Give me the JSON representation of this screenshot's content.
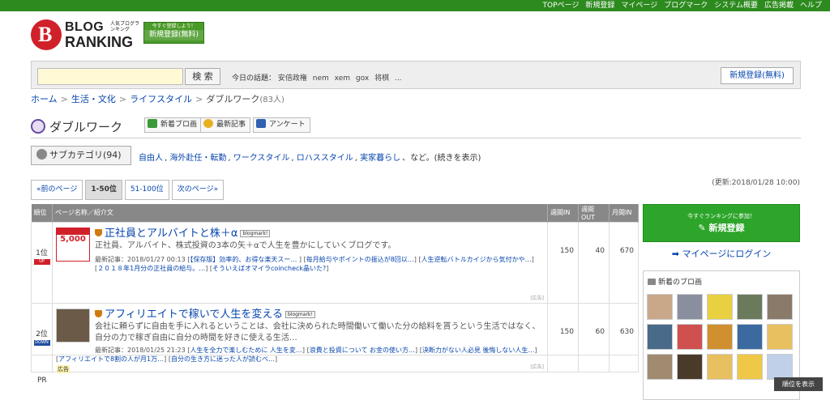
{
  "topnav": [
    "TOPページ",
    "新規登録",
    "マイページ",
    "ブログマーク",
    "システム概要",
    "広告掲載",
    "ヘルプ"
  ],
  "logo": {
    "line1": "BLOG",
    "line2": "RANKING",
    "tagline": "人気ブログランキング"
  },
  "reg_banner": {
    "small": "今すぐ登録しよう！",
    "main": "新規登録(無料)"
  },
  "search": {
    "value": "",
    "button": "検 索",
    "topics_label": "今日の話題：",
    "topics": [
      "安倍政権",
      "nem",
      "xem",
      "gox",
      "将棋",
      "..."
    ],
    "register": "新規登録(無料)"
  },
  "breadcrumb": {
    "home": "ホーム",
    "c1": "生活・文化",
    "c2": "ライフスタイル",
    "current": "ダブルワーク",
    "count": "(83人)"
  },
  "category": {
    "title": "ダブルワーク",
    "btn_new": "新着ブロ画",
    "btn_latest": "最新記事",
    "btn_survey": "アンケート"
  },
  "subcat": {
    "button": "サブカテゴリ(94)",
    "links": [
      "自由人",
      "海外赴任・転勤",
      "ワークスタイル",
      "ロハススタイル",
      "実家暮らし"
    ],
    "suffix": "など。(続きを表示)"
  },
  "updated": "(更新:2018/01/28 10:00)",
  "pager": {
    "prev": "«前のページ",
    "current": "1-50位",
    "next_range": "51-100位",
    "next": "次のページ»"
  },
  "table": {
    "headers": {
      "rank": "順位",
      "name": "ページ名称／紹介文",
      "in_week": "週間IN",
      "out_week": "週間OUT",
      "in_month": "月間IN"
    },
    "rows": [
      {
        "rank": "1位",
        "badge": "UP",
        "title": "正社員とアルバイトと株＋α",
        "bm": "blogmark!",
        "desc": "正社員、アルバイト、株式投資の3本の矢＋αで人生を豊かにしていくブログです。",
        "latest_label": "最新記事：2018/01/27 00:13 [",
        "latest_links": [
          "【保存版】効率的、お得な楽天スー…",
          "毎月給与やポイントの振込が8回以…",
          "人生逆転バトルカイジから気付かや…",
          "２０１８年1月分の正社員の給与。…",
          "そういえばオマイラcoincheck晶いた?"
        ],
        "ad": "[広告]",
        "in_week": "150",
        "out_week": "40",
        "in_month": "670",
        "thumb_text": "5,000"
      },
      {
        "rank": "2位",
        "badge": "DOWN",
        "title": "アフィリエイトで稼いで人生を変える",
        "bm": "blogmark!",
        "desc": "会社に頼らずに自由を手に入れるということは、会社に決められた時間働いて働いた分の給料を貰うという生活ではなく、自分の力で稼ぎ自由に自分の時間を好きに使える生活…",
        "latest_label": "最新記事：2018/01/25 21:23 [",
        "latest_links": [
          "人生を全力で楽しむために 人生を変…",
          "浪費と投資について お金の使い方…",
          "決断力がない人必見 後悔しない人生…",
          "アフィリエイトで8割の人が月1万…",
          "自分の生き方に迷った人が読むべ…"
        ],
        "ad": "[広告]",
        "in_week": "150",
        "out_week": "60",
        "in_month": "630"
      }
    ],
    "pr": "PR",
    "ad_label": "広告"
  },
  "sidebar": {
    "join_small": "今すぐランキングに参加！",
    "join_main": "新規登録",
    "login": "マイページにログイン",
    "new_blogs_title": "新着のブロ画"
  },
  "back_top": "順位を表示",
  "colors": {
    "topbar": "#2d8a1e",
    "join": "#2da52a",
    "link": "#0645ad"
  }
}
